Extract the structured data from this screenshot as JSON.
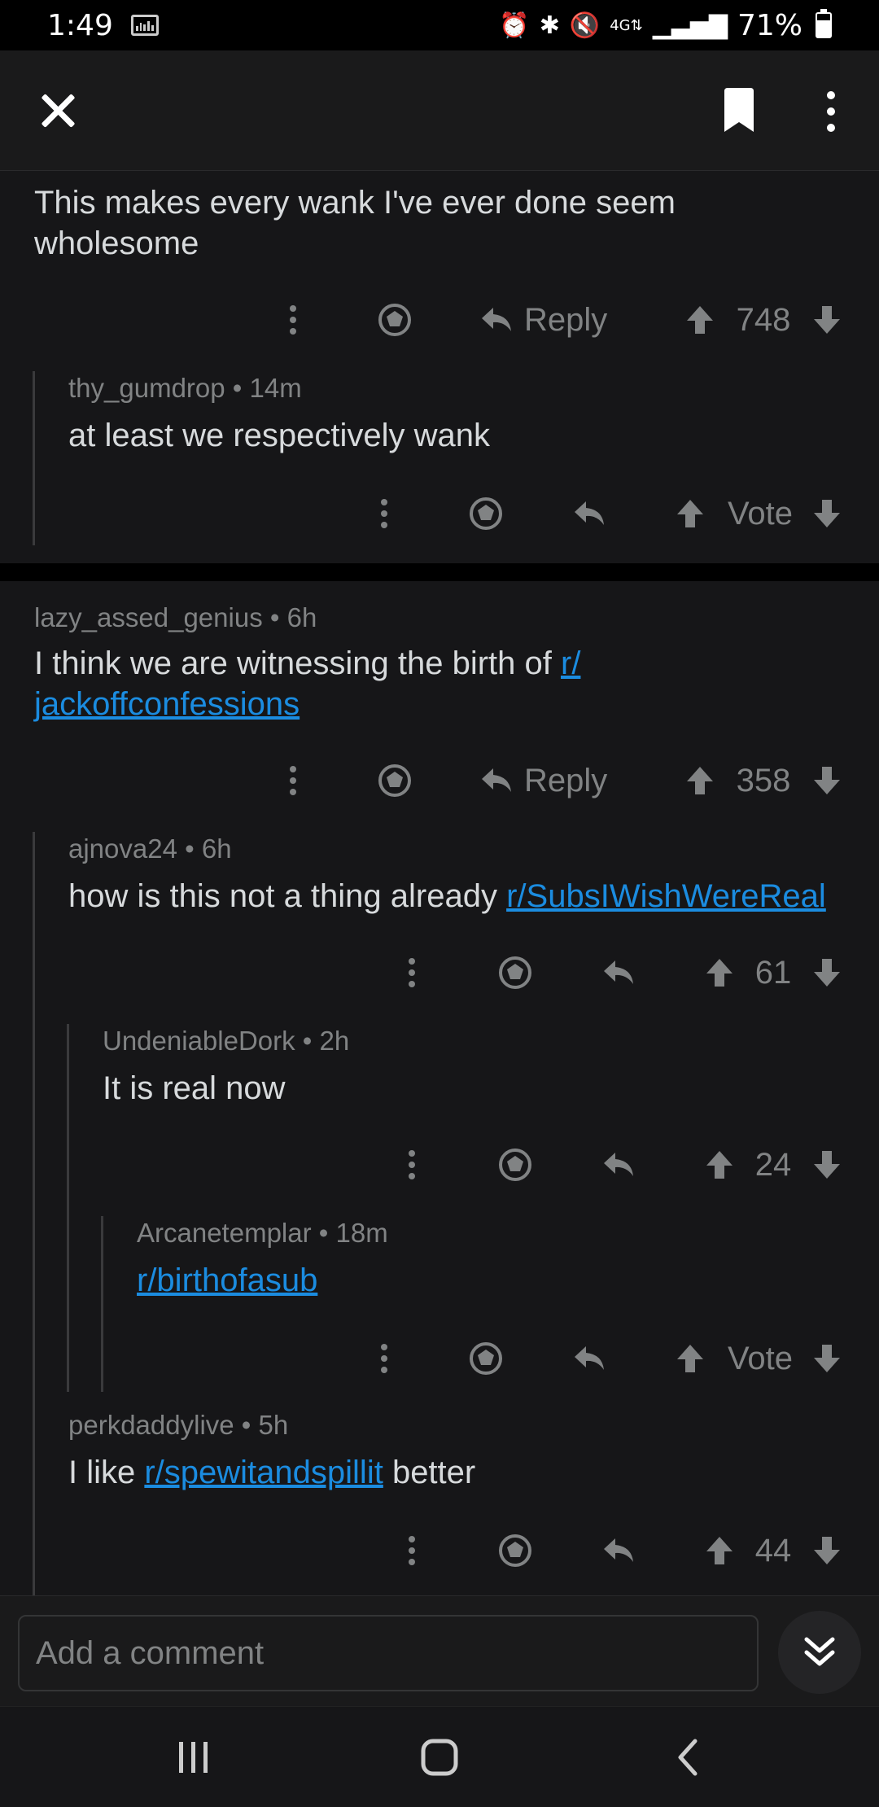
{
  "status_bar": {
    "time": "1:49",
    "battery": "71%",
    "battery_level": 0.71
  },
  "app_bar": {
    "close_icon": "close-icon",
    "bookmark_icon": "bookmark-icon",
    "more_icon": "more-vertical-icon"
  },
  "comments": [
    {
      "author": "",
      "age": "",
      "body": "This makes every wank I've ever done seem wholesome",
      "reply_label": "Reply",
      "score": "748"
    },
    {
      "author": "thy_gumdrop",
      "age": "14m",
      "body": "at least we respectively wank",
      "score": "Vote"
    },
    {
      "author": "lazy_assed_genius",
      "age": "6h",
      "body_prefix": "I think we are witnessing the birth of ",
      "link_part1": "r/",
      "link_part2": "jackoffconfessions",
      "reply_label": "Reply",
      "score": "358"
    },
    {
      "author": "ajnova24",
      "age": "6h",
      "body_prefix": "how is this not a thing already ",
      "link": "r/SubsIWishWereReal",
      "score": "61"
    },
    {
      "author": "UndeniableDork",
      "age": "2h",
      "body": "It is real now",
      "score": "24"
    },
    {
      "author": "Arcanetemplar",
      "age": "18m",
      "link": "r/birthofasub",
      "score": "Vote"
    },
    {
      "author": "perkdaddylive",
      "age": "5h",
      "body_prefix": "I like ",
      "link": "r/spewitandspillit",
      "body_suffix": " better",
      "score": "44"
    }
  ],
  "composer": {
    "placeholder": "Add a comment"
  },
  "nav_bar": {
    "recents_icon": "recents-icon",
    "home_icon": "home-icon",
    "back_icon": "back-icon"
  },
  "colors": {
    "background": "#161618",
    "link": "#1b8ce0",
    "meta": "#818384",
    "text": "#d7dadc"
  }
}
